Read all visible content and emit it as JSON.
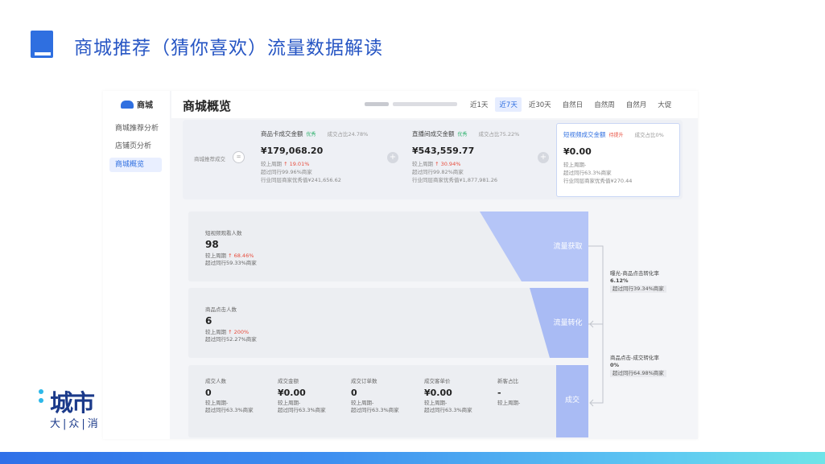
{
  "title": "商城推荐（猜你喜欢）流量数据解读",
  "sidebar": {
    "head": "商城",
    "items": [
      "商城推荐分析",
      "店铺页分析",
      "商城概览"
    ]
  },
  "header": {
    "title": "商城概览",
    "tabs": [
      "近1天",
      "近7天",
      "近30天",
      "自然日",
      "自然周",
      "自然月",
      "大促"
    ]
  },
  "kpi": {
    "left_label": "商城推荐成交",
    "eq": "=",
    "cards": [
      {
        "title": "商品卡成交金额",
        "badge": "优秀",
        "ratio": "成交占比24.78%",
        "value": "¥179,068.20",
        "l1a": "较上周期 ",
        "l1b": "↑ 19.01%",
        "l2": "超过同行99.96%商家",
        "l3": "行业同层商家优秀值¥241,656.62"
      },
      {
        "title": "直播间成交金额",
        "badge": "优秀",
        "ratio": "成交占比75.22%",
        "value": "¥543,559.77",
        "l1a": "较上周期 ",
        "l1b": "↑ 30.94%",
        "l2": "超过同行99.82%商家",
        "l3": "行业同层商家优秀值¥1,877,981.26"
      },
      {
        "title": "短视频成交金额",
        "badge": "待提升",
        "ratio": "成交占比0%",
        "value": "¥0.00",
        "l1a": "较上周期-",
        "l1b": "",
        "l2": "超过同行63.3%商家",
        "l3": "行业同层商家优秀值¥270.44"
      }
    ]
  },
  "funnel": {
    "p1": {
      "title": "短视频观看人数",
      "value": "98",
      "l1a": "较上周期 ",
      "l1b": "↑ 68.46%",
      "l2": "超过同行59.33%商家",
      "stage": "流量获取"
    },
    "p2": {
      "title": "商品点击人数",
      "value": "6",
      "l1a": "较上周期 ",
      "l1b": "↑ 200%",
      "l2": "超过同行52.27%商家",
      "stage": "流量转化"
    },
    "p3": {
      "stage": "成交",
      "cols": [
        {
          "t": "成交人数",
          "v": "0",
          "a": "较上周期-",
          "b": "超过同行63.3%商家"
        },
        {
          "t": "成交金额",
          "v": "¥0.00",
          "a": "较上周期-",
          "b": "超过同行63.3%商家"
        },
        {
          "t": "成交订单数",
          "v": "0",
          "a": "较上周期-",
          "b": "超过同行63.3%商家"
        },
        {
          "t": "成交客单价",
          "v": "¥0.00",
          "a": "较上周期-",
          "b": "超过同行63.3%商家"
        },
        {
          "t": "新客占比",
          "v": "-",
          "a": "较上周期-",
          "b": ""
        }
      ]
    },
    "c1": {
      "t": "曝光-商品点击转化率",
      "v": "6.12%",
      "b": "超过同行39.34%商家"
    },
    "c2": {
      "t": "商品点击-成交转化率",
      "v": "0%",
      "b": "超过同行64.98%商家"
    }
  },
  "brand": {
    "main": "城市",
    "sub": "大|众|消"
  },
  "colors": {
    "accent": "#2f6fe0",
    "funnel": "#b5c5f7",
    "stage": "#9db3f2"
  }
}
